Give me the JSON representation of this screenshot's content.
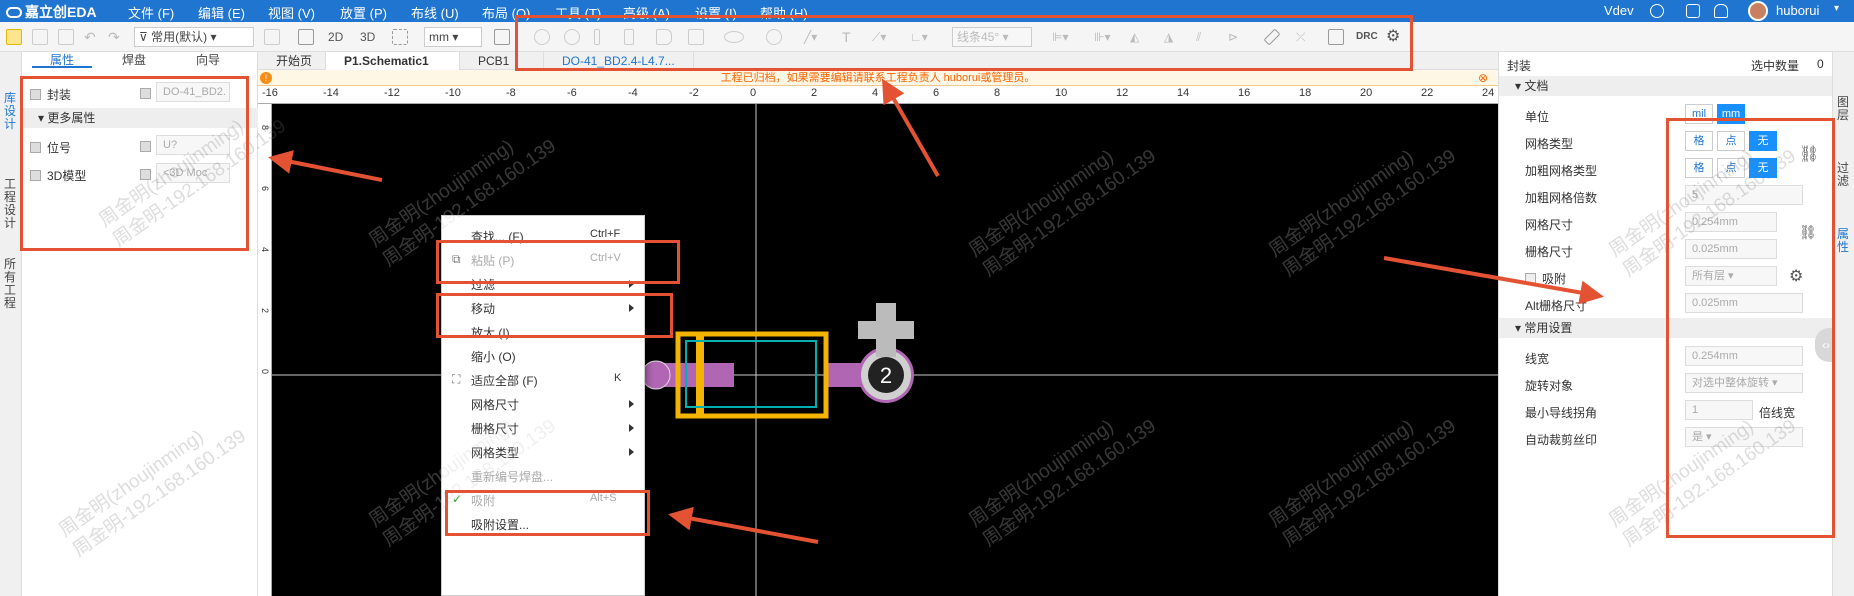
{
  "app": {
    "logo": "嘉立创EDA",
    "user": "huborui",
    "version": "Vdev"
  },
  "menu": [
    "文件 (F)",
    "编辑 (E)",
    "视图 (V)",
    "放置 (P)",
    "布线 (U)",
    "布局 (O)",
    "工具 (T)",
    "高级 (A)",
    "设置 (I)",
    "帮助 (H)"
  ],
  "toolbar": {
    "filter": "常用(默认)",
    "view2d": "2D",
    "view3d": "3D",
    "unit": "mm",
    "line_mode": "线条45°",
    "drc": "DRC"
  },
  "left_tabs": [
    "库设计",
    "工程设计",
    "所有工程"
  ],
  "left_panel": {
    "tabs": [
      "属性",
      "焊盘",
      "向导"
    ],
    "rows": [
      {
        "label": "封装",
        "value": "DO-41_BD2."
      }
    ],
    "section": "更多属性",
    "rows2": [
      {
        "label": "位号",
        "value": "U?"
      },
      {
        "label": "3D模型",
        "value": "<3D Moc"
      }
    ]
  },
  "doc_tabs": [
    "开始页",
    "P1.Schematic1",
    "PCB1",
    "DO-41_BD2.4-L4.7..."
  ],
  "notice": "工程已归档，如果需要编辑请联系工程负责人 huborui或管理员。",
  "ruler_x": [
    "-16",
    "-14",
    "-12",
    "-10",
    "-8",
    "-6",
    "-4",
    "-2",
    "0",
    "2",
    "4",
    "6",
    "8",
    "10",
    "12",
    "14",
    "16",
    "18",
    "20",
    "22",
    "24"
  ],
  "ruler_y": [
    "8",
    "6",
    "4",
    "2",
    "0"
  ],
  "pad_label": "2",
  "context_menu": {
    "items": [
      {
        "label": "查找... (F)",
        "shortcut": "Ctrl+F",
        "disabled": false
      },
      {
        "label": "粘贴 (P)",
        "shortcut": "Ctrl+V",
        "disabled": true
      },
      {
        "label": "过滤",
        "shortcut": "",
        "disabled": false,
        "sub": true
      },
      {
        "label": "移动",
        "shortcut": "",
        "disabled": false,
        "sub": true
      },
      {
        "label": "放大 (I)",
        "shortcut": "",
        "disabled": false
      },
      {
        "label": "缩小 (O)",
        "shortcut": "",
        "disabled": false
      },
      {
        "label": "适应全部 (F)",
        "shortcut": "K",
        "disabled": false
      },
      {
        "label": "网格尺寸",
        "shortcut": "",
        "disabled": false,
        "sub": true
      },
      {
        "label": "栅格尺寸",
        "shortcut": "",
        "disabled": false,
        "sub": true
      },
      {
        "label": "网格类型",
        "shortcut": "",
        "disabled": false,
        "sub": true
      },
      {
        "label": "重新编号焊盘...",
        "shortcut": "",
        "disabled": true
      },
      {
        "label": "吸附",
        "shortcut": "Alt+S",
        "disabled": true
      },
      {
        "label": "吸附设置...",
        "shortcut": "",
        "disabled": false
      }
    ]
  },
  "right_panel": {
    "title": "封装",
    "selected_label": "选中数量",
    "selected_count": "0",
    "doc_section": "文档",
    "unit_label": "单位",
    "unit_opts": [
      "mil",
      "mm"
    ],
    "grid_type_label": "网格类型",
    "grid_opts": [
      "格",
      "点",
      "无"
    ],
    "bold_grid_label": "加粗网格类型",
    "bold_grid_opts": [
      "格",
      "点",
      "无"
    ],
    "bold_mult_label": "加粗网格倍数",
    "bold_mult": "5",
    "grid_size_label": "网格尺寸",
    "grid_size": "0.254mm",
    "snap_grid_label": "栅格尺寸",
    "snap_grid": "0.025mm",
    "snap_label": "吸附",
    "snap_value": "所有层",
    "alt_grid_label": "Alt栅格尺寸",
    "alt_grid": "0.025mm",
    "common_section": "常用设置",
    "line_width_label": "线宽",
    "line_width": "0.254mm",
    "rotate_label": "旋转对象",
    "rotate_value": "对选中整体旋转",
    "min_track_label": "最小导线拐角",
    "min_track": "1",
    "min_track_unit": "倍线宽",
    "auto_cut_label": "自动裁剪丝印",
    "auto_cut": "是"
  },
  "right_tabs": [
    "图层",
    "过滤",
    "属性"
  ],
  "watermark": "周金明(zhoujinming) 周金明-192.168.160.139"
}
